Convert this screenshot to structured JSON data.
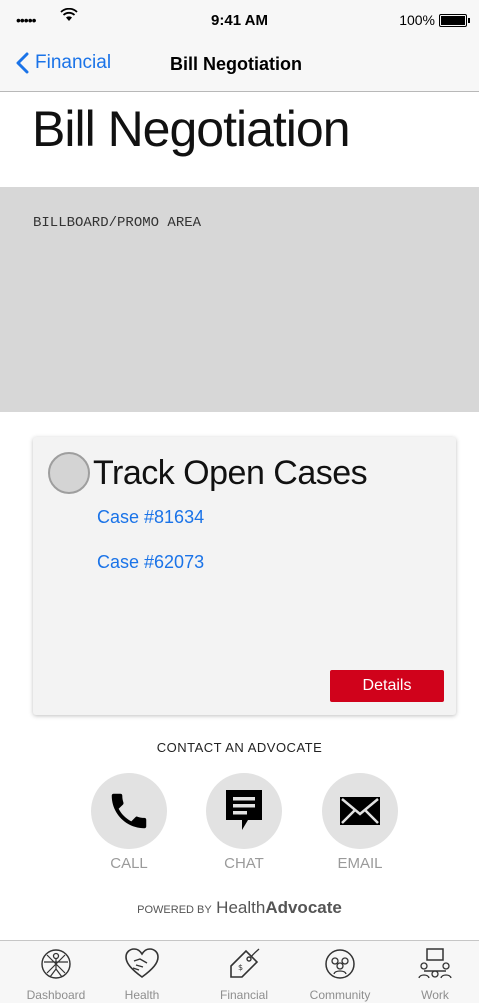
{
  "status_bar": {
    "signal": "•••••",
    "time": "9:41 AM",
    "battery": "100%"
  },
  "nav": {
    "back_label": "Financial",
    "title": "Bill Negotiation"
  },
  "page_title": "Bill Negotiation",
  "promo": {
    "label": "BILLBOARD/PROMO AREA"
  },
  "card": {
    "title": "Track Open Cases",
    "cases": [
      "Case #81634",
      "Case #62073"
    ],
    "details_label": "Details"
  },
  "contact": {
    "heading": "CONTACT AN ADVOCATE",
    "buttons": [
      {
        "label": "CALL",
        "icon": "phone-icon"
      },
      {
        "label": "CHAT",
        "icon": "chat-icon"
      },
      {
        "label": "EMAIL",
        "icon": "email-icon"
      }
    ]
  },
  "powered": {
    "prefix": "POWERED BY",
    "brand_light": "Health",
    "brand_bold": "Advocate"
  },
  "tabs": [
    {
      "label": "Dashboard",
      "icon": "vitruvian-icon"
    },
    {
      "label": "Health",
      "icon": "heart-hands-icon"
    },
    {
      "label": "Financial",
      "icon": "price-tag-icon"
    },
    {
      "label": "Community",
      "icon": "community-icon"
    },
    {
      "label": "Work",
      "icon": "meeting-icon"
    }
  ],
  "colors": {
    "accent": "#1a73e8",
    "details_button": "#d0021b",
    "promo_bg": "#d7d7d7"
  }
}
